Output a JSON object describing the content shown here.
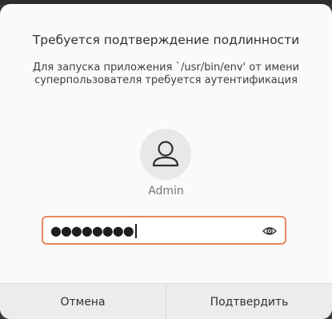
{
  "dialog": {
    "title": "Требуется подтверждение подлинности",
    "message": "Для запуска приложения `/usr/bin/env' от имени суперпользователя требуется аутентификация",
    "user": {
      "name": "Admin",
      "avatar_icon": "user-silhouette-icon"
    },
    "password": {
      "masked_value": "●●●●●●●●",
      "reveal_icon": "eye-icon"
    },
    "buttons": {
      "cancel_label": "Отмена",
      "confirm_label": "Подтвердить"
    }
  },
  "colors": {
    "accent_border": "#e9855e",
    "dialog_bg": "#fafafa",
    "button_bar_bg": "#ececec"
  }
}
